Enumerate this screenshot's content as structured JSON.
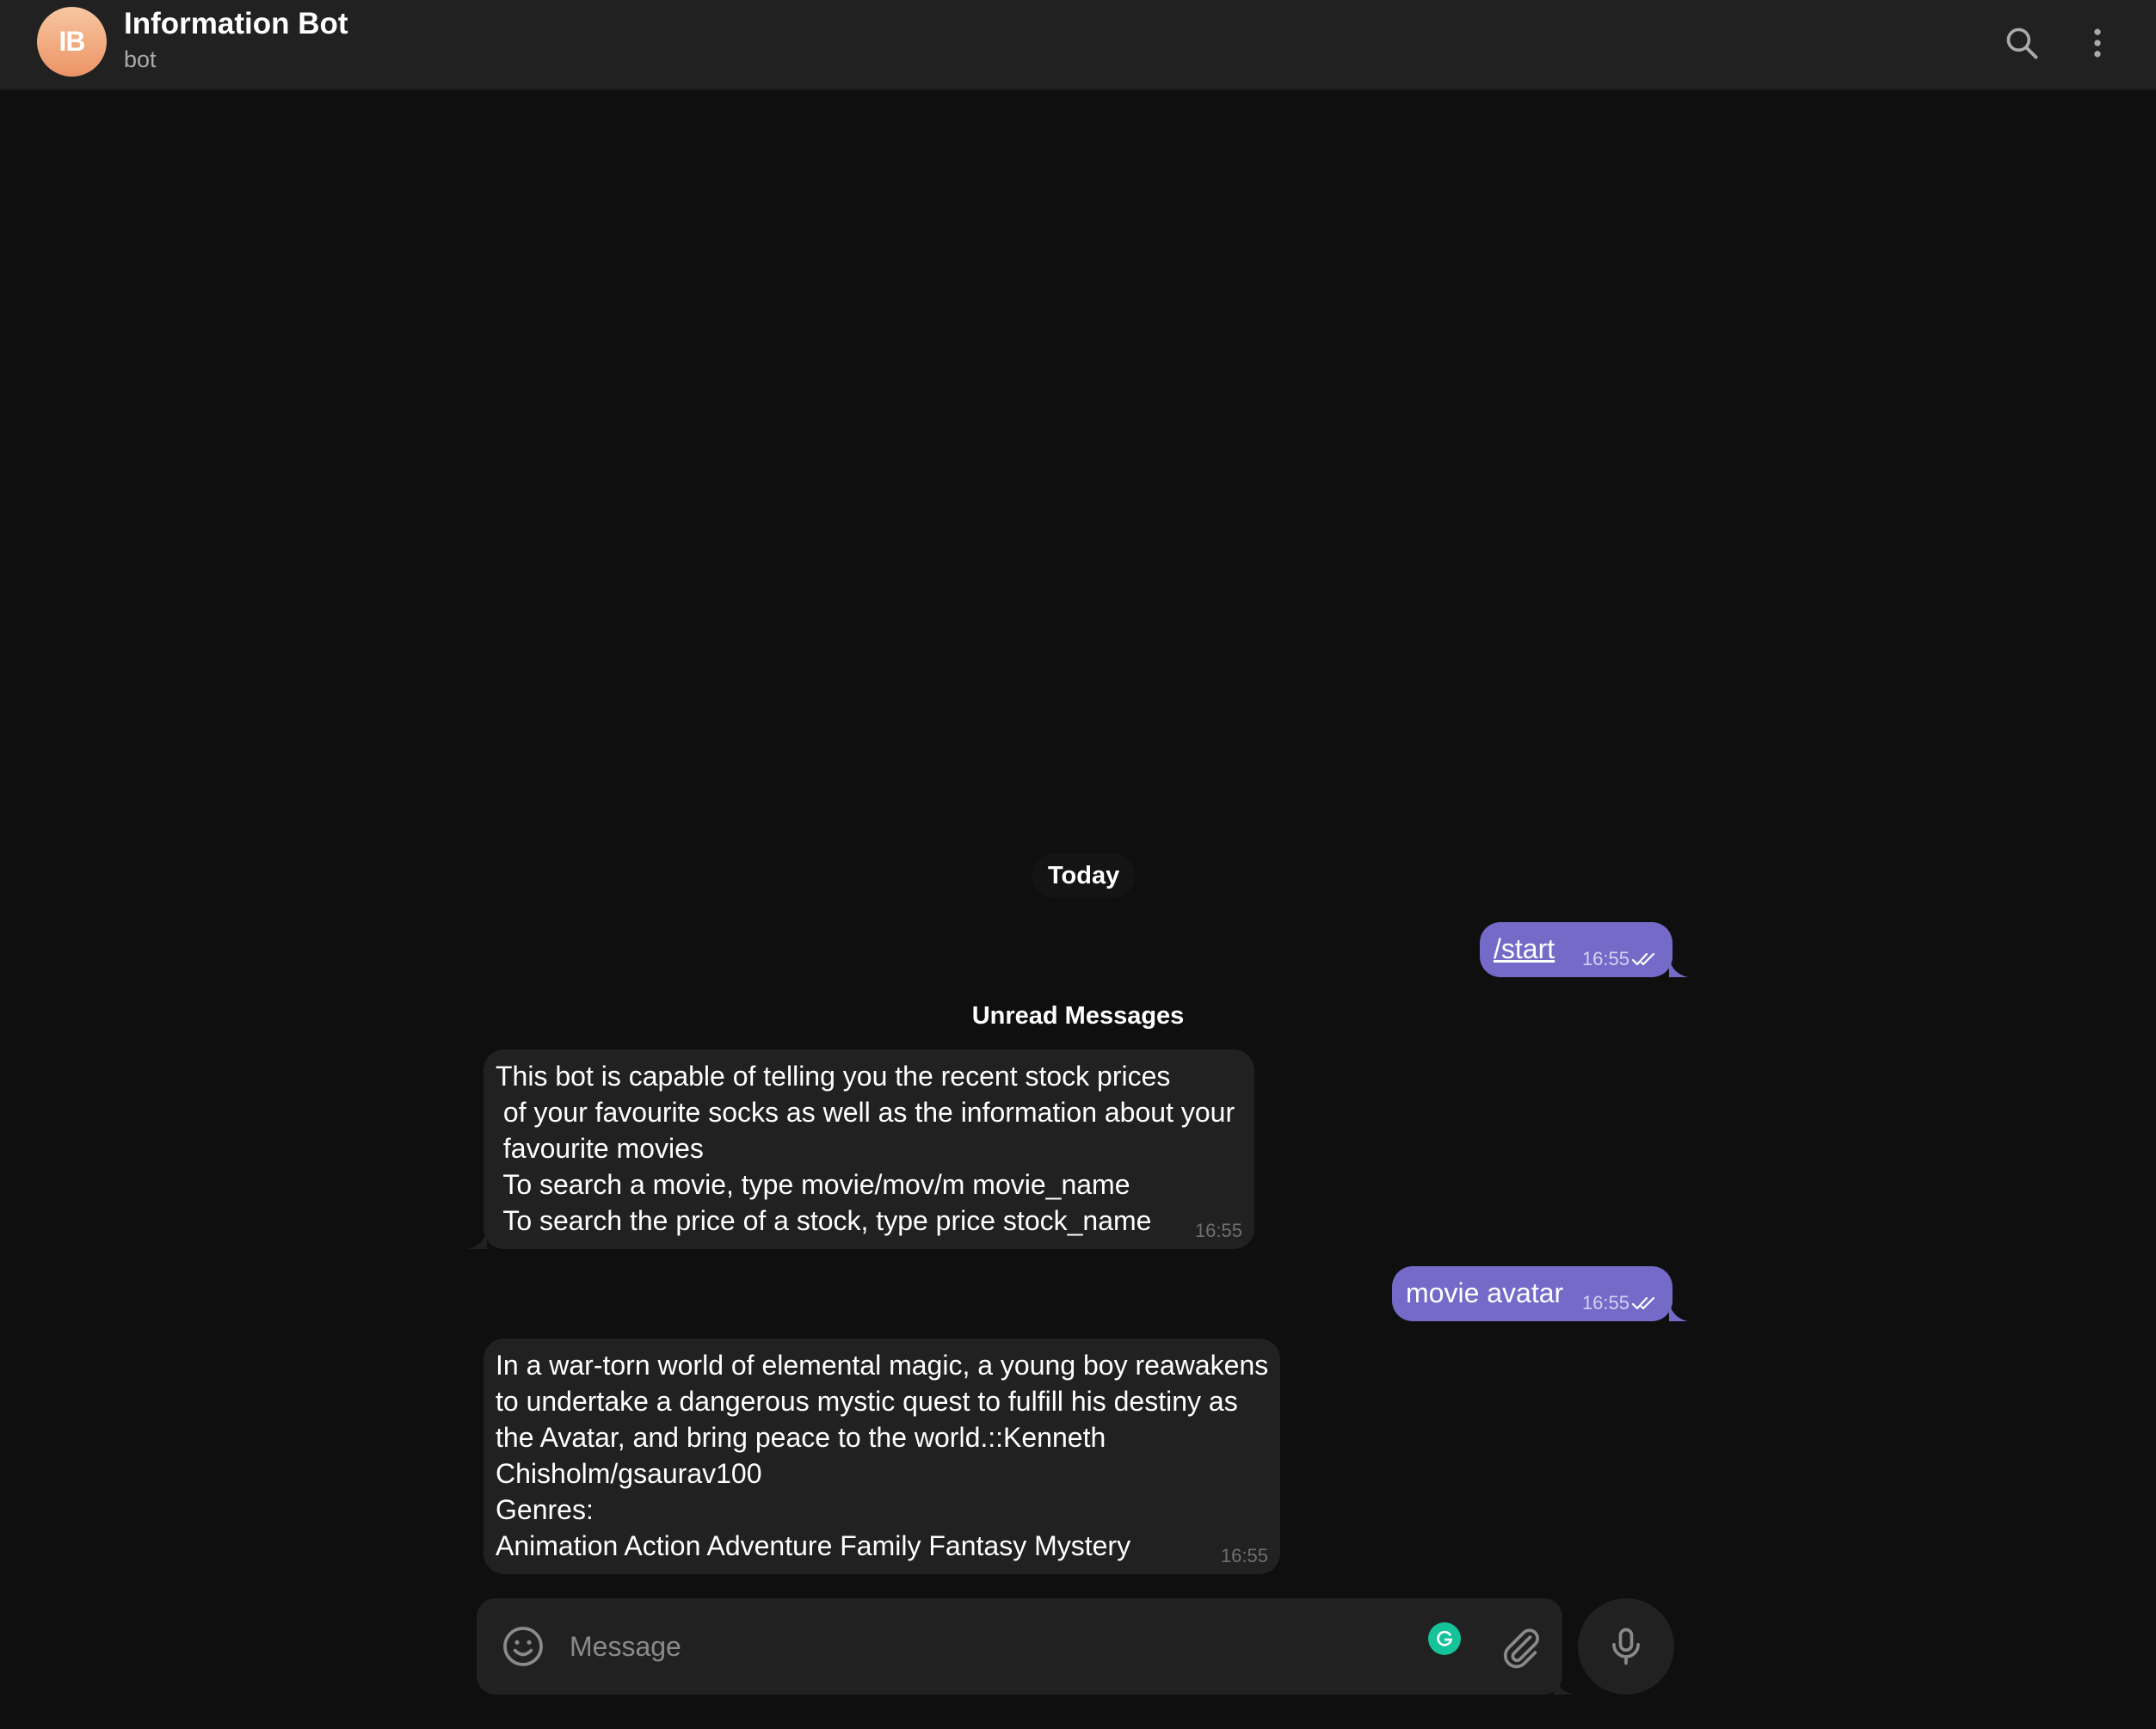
{
  "header": {
    "avatar_initials": "IB",
    "title": "Information Bot",
    "status": "bot",
    "icons": [
      "search-icon",
      "more-vertical-icon"
    ]
  },
  "chat": {
    "date_separator": "Today",
    "unread_separator": "Unread Messages",
    "messages": [
      {
        "direction": "outgoing",
        "text": "/start",
        "time": "16:55",
        "status": "read"
      },
      {
        "direction": "incoming",
        "text": "This bot is capable of telling you the recent stock prices\n of your favourite socks as well as the information about your\n favourite movies\n To search a movie, type movie/mov/m movie_name\n To search the price of a stock, type price stock_name",
        "time": "16:55"
      },
      {
        "direction": "outgoing",
        "text": "movie avatar",
        "time": "16:55",
        "status": "read"
      },
      {
        "direction": "incoming",
        "text": "In a war-torn world of elemental magic, a young boy reawakens\nto undertake a dangerous mystic quest to fulfill his destiny as\nthe Avatar, and bring peace to the world.::Kenneth\nChisholm/gsaurav100\nGenres:\nAnimation Action Adventure Family Fantasy Mystery",
        "time": "16:55"
      }
    ]
  },
  "composer": {
    "placeholder": "Message",
    "value": "",
    "icons": [
      "emoji-icon",
      "grammarly-icon",
      "attach-icon",
      "microphone-icon"
    ]
  },
  "colors": {
    "background": "#0f0f0f",
    "header": "#212121",
    "outgoing_bubble": "#766ac8",
    "incoming_bubble": "#212121",
    "avatar_gradient": [
      "#f7c6a1",
      "#ec9466"
    ],
    "grammarly": "#15c39a"
  }
}
